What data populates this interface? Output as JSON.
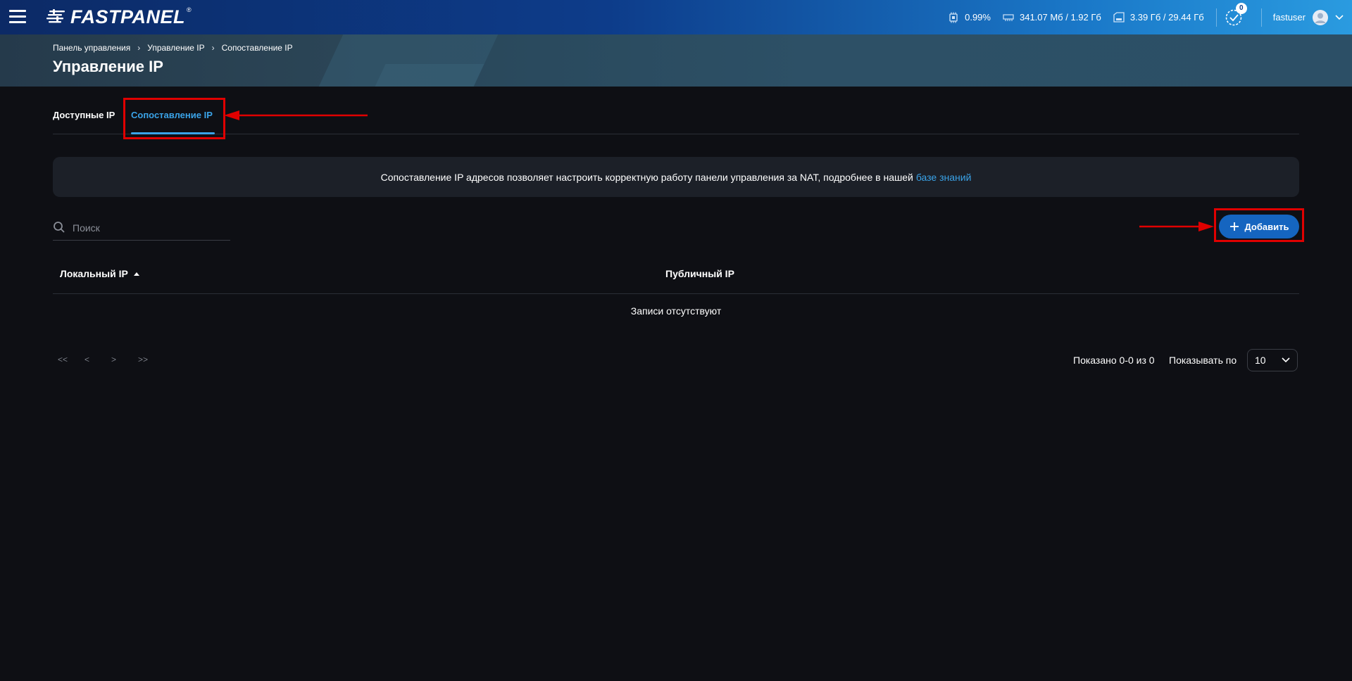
{
  "topbar": {
    "logo_text": "FASTPANEL",
    "logo_reg": "®",
    "cpu": "0.99%",
    "ram": "341.07 Мб / 1.92 Гб",
    "disk": "3.39 Гб / 29.44 Гб",
    "notifications_count": "0",
    "username": "fastuser"
  },
  "breadcrumb": [
    "Панель управления",
    "Управление IP",
    "Сопоставление IP"
  ],
  "page_title": "Управление IP",
  "tabs": [
    {
      "label": "Доступные IP",
      "active": false
    },
    {
      "label": "Сопоставление IP",
      "active": true
    }
  ],
  "info": {
    "text": "Сопоставление IP адресов позволяет настроить корректную работу панели управления за NAT, подробнее в нашей",
    "link": "базе знаний"
  },
  "search": {
    "placeholder": "Поиск",
    "value": ""
  },
  "add_button": "Добавить",
  "table": {
    "columns": [
      "Локальный IP",
      "Публичный IP"
    ],
    "empty_text": "Записи отсутствуют"
  },
  "pagination": {
    "first": "<<",
    "prev": "<",
    "next": ">",
    "last": ">>",
    "shown": "Показано 0-0 из 0",
    "per_page_label": "Показывать по",
    "per_page_value": "10"
  },
  "colors": {
    "accent": "#3aa3e8",
    "button": "#1565c0",
    "annotation": "#e00000",
    "background": "#0e0f14"
  }
}
